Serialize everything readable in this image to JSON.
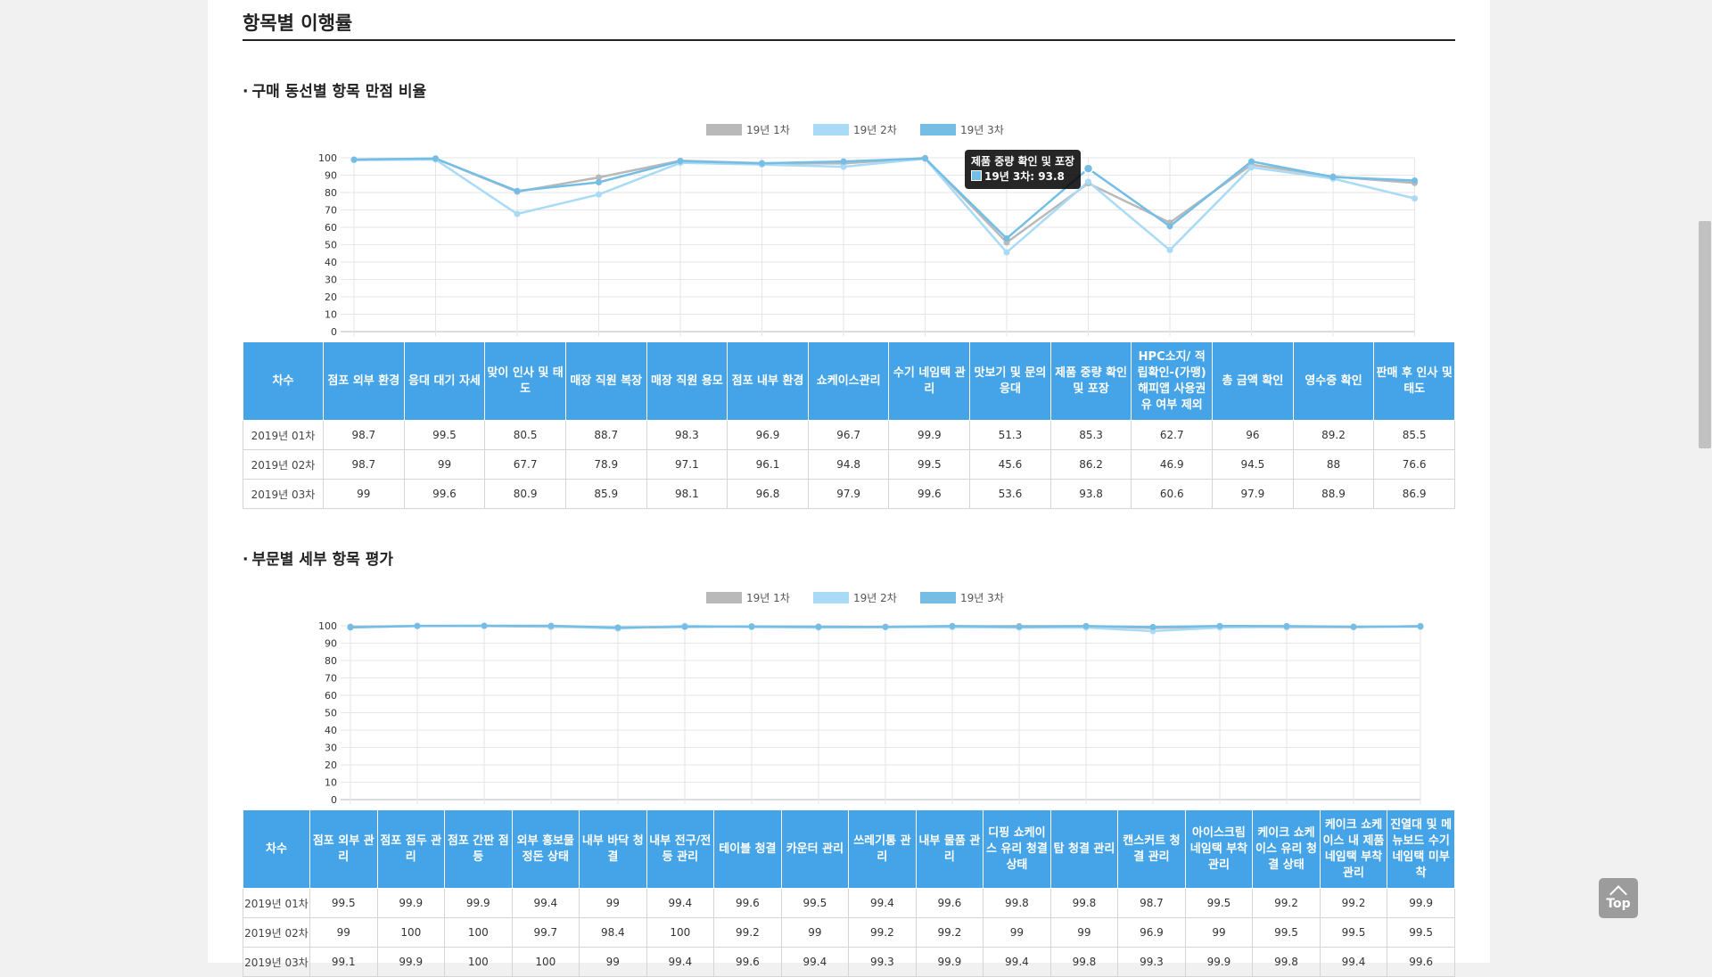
{
  "page_title": "항목별 이행률",
  "top_button_label": "Top",
  "colors": {
    "series1": "#b9b9b9",
    "series2": "#a9daf6",
    "series3": "#74bee6",
    "table_header": "#45a4e8"
  },
  "section1": {
    "title": "구매 동선별 항목 만점 비율",
    "bullet": "·",
    "table_first_header": "차수",
    "row_labels": [
      "2019년 01차",
      "2019년 02차",
      "2019년 03차"
    ],
    "tooltip": {
      "title": "제품 중량 확인 및 포장",
      "text": "19년 3차: 93.8"
    }
  },
  "section2": {
    "title": "부문별 세부 항목 평가",
    "bullet": "·",
    "table_first_header": "차수",
    "row_labels": [
      "2019년 01차",
      "2019년 02차",
      "2019년 03차"
    ]
  },
  "chart_data": [
    {
      "type": "line",
      "ylim": [
        0,
        100
      ],
      "yticks": [
        0,
        10,
        20,
        30,
        40,
        50,
        60,
        70,
        80,
        90,
        100
      ],
      "legend_position": "top-center",
      "grid": true,
      "categories": [
        "점포 외부 환경",
        "응대 대기 자세",
        "맞이 인사 및 태도",
        "매장 직원 복장",
        "매장 직원 용모",
        "점포 내부 환경",
        "쇼케이스관리",
        "수기 네임택 관리",
        "맛보기 및 문의 응대",
        "제품 중량 확인 및 포장",
        "HPC소지/ 적립확인-(가맹)해피앱 사용권유 여부 제외",
        "총 금액 확인",
        "영수증 확인",
        "판매 후 인사 및 태도"
      ],
      "series": [
        {
          "name": "19년 1차",
          "values": [
            98.7,
            99.5,
            80.5,
            88.7,
            98.3,
            96.9,
            96.7,
            99.9,
            51.3,
            85.3,
            62.7,
            96,
            89.2,
            85.5
          ]
        },
        {
          "name": "19년 2차",
          "values": [
            98.7,
            99,
            67.7,
            78.9,
            97.1,
            96.1,
            94.8,
            99.5,
            45.6,
            86.2,
            46.9,
            94.5,
            88,
            76.6
          ]
        },
        {
          "name": "19년 3차",
          "values": [
            99,
            99.6,
            80.9,
            85.9,
            98.1,
            96.8,
            97.9,
            99.6,
            53.6,
            93.8,
            60.6,
            97.9,
            88.9,
            86.9
          ]
        }
      ]
    },
    {
      "type": "line",
      "ylim": [
        0,
        100
      ],
      "yticks": [
        0,
        10,
        20,
        30,
        40,
        50,
        60,
        70,
        80,
        90,
        100
      ],
      "legend_position": "top-center",
      "grid": true,
      "categories": [
        "점포 외부 관리",
        "점포 점두 관리",
        "점포 간판 점등",
        "외부 홍보물 정돈 상태",
        "내부 바닥 청결",
        "내부 전구/전등 관리",
        "테이블 청결",
        "카운터 관리",
        "쓰레기통 관리",
        "내부 물품 관리",
        "디핑 쇼케이스 유리 청결 상태",
        "탑 청결 관리",
        "캔스커트 청결 관리",
        "아이스크림 네임택 부착 관리",
        "케이크 쇼케이스 유리 청결 상태",
        "케이크 쇼케이스 내 제품 네임택 부착 관리",
        "진열대 및 메뉴보드 수기 네임택 미부착"
      ],
      "series": [
        {
          "name": "19년 1차",
          "values": [
            99.5,
            99.9,
            99.9,
            99.4,
            99,
            99.4,
            99.6,
            99.5,
            99.4,
            99.6,
            99.8,
            99.8,
            98.7,
            99.5,
            99.2,
            99.2,
            99.9
          ]
        },
        {
          "name": "19년 2차",
          "values": [
            99,
            100,
            100,
            99.7,
            98.4,
            100,
            99.2,
            99,
            99.2,
            99.2,
            99,
            99,
            96.9,
            99,
            99.5,
            99.5,
            99.5
          ]
        },
        {
          "name": "19년 3차",
          "values": [
            99.1,
            99.9,
            100,
            100,
            99,
            99.4,
            99.6,
            99.4,
            99.3,
            99.9,
            99.4,
            99.8,
            99.3,
            99.9,
            99.8,
            99.4,
            99.6
          ]
        }
      ]
    }
  ]
}
